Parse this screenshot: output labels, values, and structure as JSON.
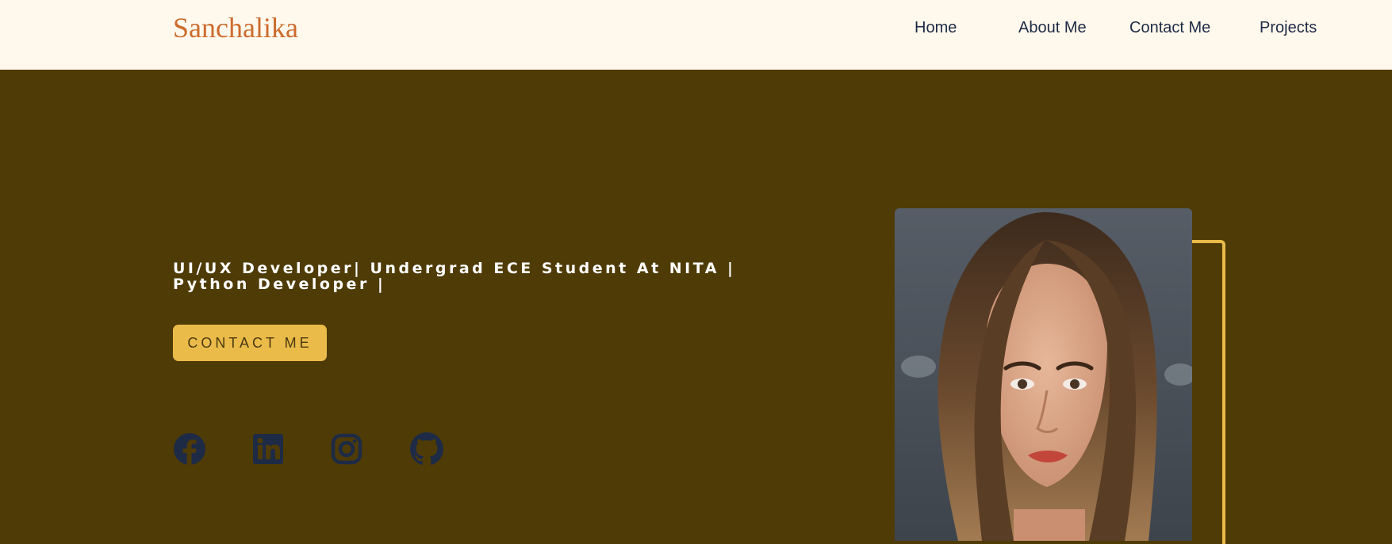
{
  "header": {
    "logo": "Sanchalika",
    "nav": [
      {
        "label": "Home"
      },
      {
        "label": "About Me"
      },
      {
        "label": "Contact Me"
      },
      {
        "label": "Projects"
      }
    ]
  },
  "hero": {
    "tagline": "UI/UX Developer| Undergrad ECE Student At NITA | Python Developer |",
    "cta_label": "CONTACT ME",
    "social": [
      {
        "icon": "facebook-icon"
      },
      {
        "icon": "linkedin-icon"
      },
      {
        "icon": "instagram-icon"
      },
      {
        "icon": "github-icon"
      }
    ]
  },
  "colors": {
    "header_bg": "#fff8ec",
    "hero_bg": "#4f3b06",
    "accent": "#ebbb4a",
    "logo": "#cc6b2e",
    "nav_text": "#1e2b46",
    "icons": "#1e2b46"
  }
}
